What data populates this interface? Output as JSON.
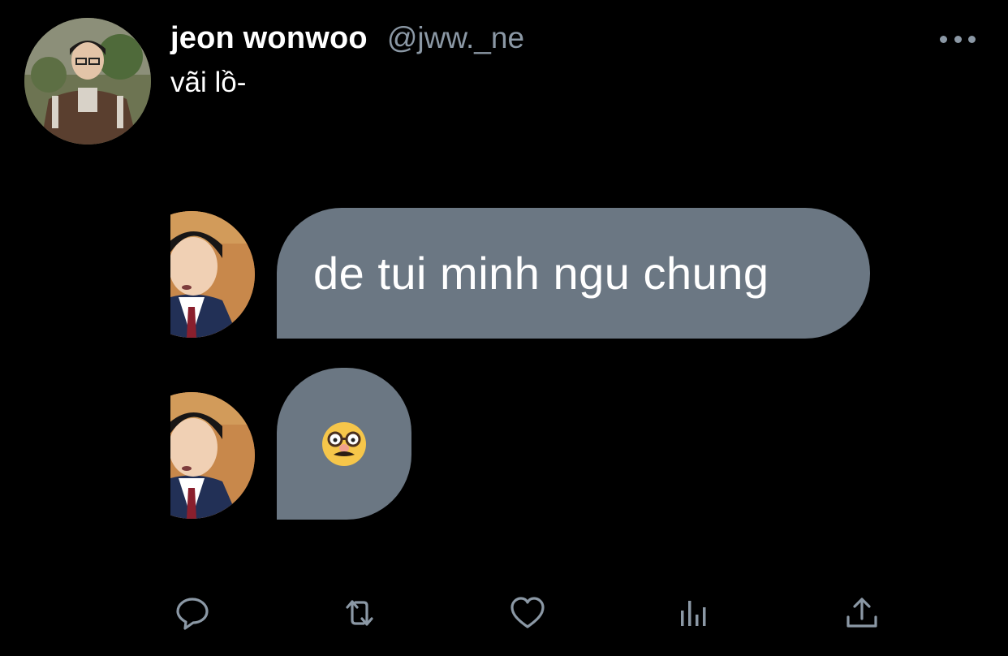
{
  "tweet": {
    "author": {
      "display_name": "jeon wonwoo",
      "handle": "@jww._ne",
      "avatar_icon": "profile-photo"
    },
    "text": "vãi lồ-",
    "more_icon": "more-dots-icon"
  },
  "media": {
    "messages": [
      {
        "type": "text",
        "text": "de tui minh ngu chung"
      },
      {
        "type": "emoji",
        "emoji": "🥸",
        "emoji_icon": "disguised-face-emoji"
      }
    ],
    "bubble_color": "#6b7783"
  },
  "actions": [
    {
      "name": "reply",
      "icon": "reply-icon"
    },
    {
      "name": "retweet",
      "icon": "retweet-icon"
    },
    {
      "name": "like",
      "icon": "heart-icon"
    },
    {
      "name": "analytics",
      "icon": "analytics-icon"
    },
    {
      "name": "share",
      "icon": "share-icon"
    }
  ],
  "colors": {
    "background": "#000000",
    "secondary_text": "#8b98a5",
    "primary_text": "#ffffff"
  }
}
